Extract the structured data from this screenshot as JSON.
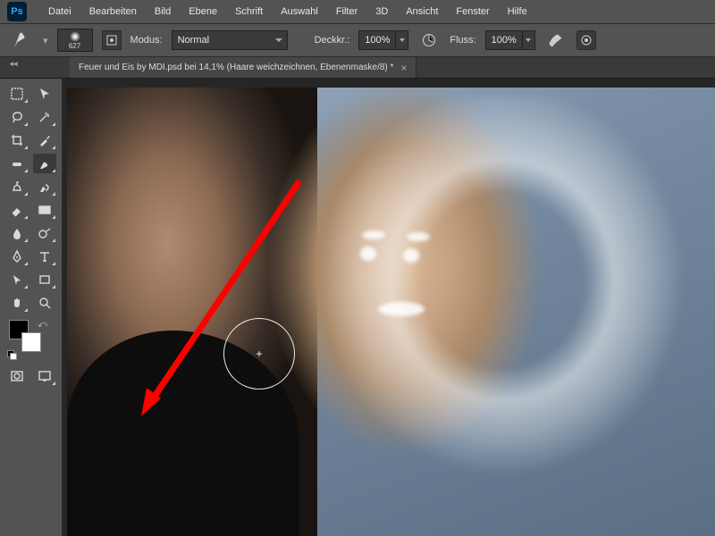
{
  "app": {
    "logo_text": "Ps"
  },
  "menu": {
    "file": "Datei",
    "edit": "Bearbeiten",
    "image": "Bild",
    "layer": "Ebene",
    "type": "Schrift",
    "select": "Auswahl",
    "filter": "Filter",
    "threeD": "3D",
    "view": "Ansicht",
    "window": "Fenster",
    "help": "Hilfe"
  },
  "options": {
    "brush_size": "627",
    "mode_label": "Modus:",
    "mode_value": "Normal",
    "opacity_label": "Deckkr.:",
    "opacity_value": "100%",
    "flow_label": "Fluss:",
    "flow_value": "100%"
  },
  "tab": {
    "title": "Feuer und Eis by MDI.psd bei 14,1% (Haare weichzeichnen, Ebenenmaske/8) *",
    "close": "×"
  },
  "colors": {
    "fg": "#000000",
    "bg": "#ffffff"
  },
  "tool_names": {
    "move": "move-tool",
    "marquee": "rectangular-marquee-tool",
    "lasso": "lasso-tool",
    "wand": "magic-wand-tool",
    "crop": "crop-tool",
    "eyedropper": "eyedropper-tool",
    "heal": "spot-healing-brush-tool",
    "brush": "brush-tool",
    "stamp": "clone-stamp-tool",
    "history": "history-brush-tool",
    "eraser": "eraser-tool",
    "gradient": "gradient-tool",
    "blur": "blur-tool",
    "dodge": "dodge-tool",
    "pen": "pen-tool",
    "type": "type-tool",
    "path": "path-selection-tool",
    "shape": "rectangle-tool",
    "hand": "hand-tool",
    "zoom": "zoom-tool"
  }
}
